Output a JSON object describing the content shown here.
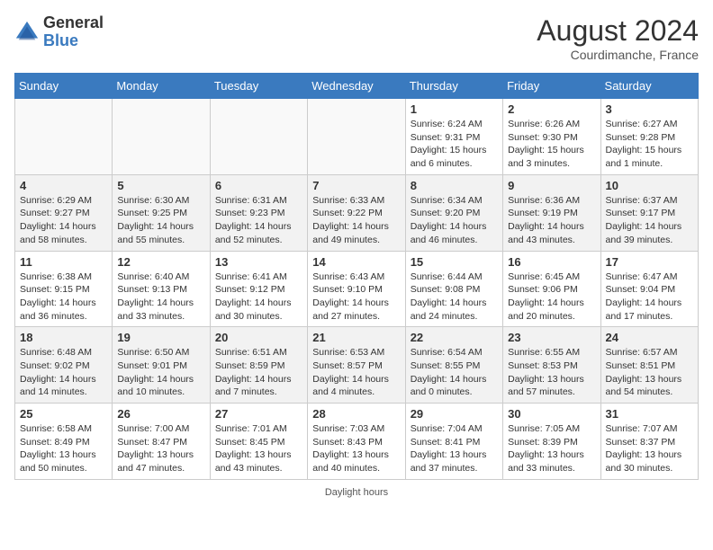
{
  "header": {
    "logo_general": "General",
    "logo_blue": "Blue",
    "month_year": "August 2024",
    "location": "Courdimanche, France"
  },
  "footer": {
    "note": "Daylight hours"
  },
  "weekdays": [
    "Sunday",
    "Monday",
    "Tuesday",
    "Wednesday",
    "Thursday",
    "Friday",
    "Saturday"
  ],
  "weeks": [
    [
      {
        "day": "",
        "info": ""
      },
      {
        "day": "",
        "info": ""
      },
      {
        "day": "",
        "info": ""
      },
      {
        "day": "",
        "info": ""
      },
      {
        "day": "1",
        "info": "Sunrise: 6:24 AM\nSunset: 9:31 PM\nDaylight: 15 hours\nand 6 minutes."
      },
      {
        "day": "2",
        "info": "Sunrise: 6:26 AM\nSunset: 9:30 PM\nDaylight: 15 hours\nand 3 minutes."
      },
      {
        "day": "3",
        "info": "Sunrise: 6:27 AM\nSunset: 9:28 PM\nDaylight: 15 hours\nand 1 minute."
      }
    ],
    [
      {
        "day": "4",
        "info": "Sunrise: 6:29 AM\nSunset: 9:27 PM\nDaylight: 14 hours\nand 58 minutes."
      },
      {
        "day": "5",
        "info": "Sunrise: 6:30 AM\nSunset: 9:25 PM\nDaylight: 14 hours\nand 55 minutes."
      },
      {
        "day": "6",
        "info": "Sunrise: 6:31 AM\nSunset: 9:23 PM\nDaylight: 14 hours\nand 52 minutes."
      },
      {
        "day": "7",
        "info": "Sunrise: 6:33 AM\nSunset: 9:22 PM\nDaylight: 14 hours\nand 49 minutes."
      },
      {
        "day": "8",
        "info": "Sunrise: 6:34 AM\nSunset: 9:20 PM\nDaylight: 14 hours\nand 46 minutes."
      },
      {
        "day": "9",
        "info": "Sunrise: 6:36 AM\nSunset: 9:19 PM\nDaylight: 14 hours\nand 43 minutes."
      },
      {
        "day": "10",
        "info": "Sunrise: 6:37 AM\nSunset: 9:17 PM\nDaylight: 14 hours\nand 39 minutes."
      }
    ],
    [
      {
        "day": "11",
        "info": "Sunrise: 6:38 AM\nSunset: 9:15 PM\nDaylight: 14 hours\nand 36 minutes."
      },
      {
        "day": "12",
        "info": "Sunrise: 6:40 AM\nSunset: 9:13 PM\nDaylight: 14 hours\nand 33 minutes."
      },
      {
        "day": "13",
        "info": "Sunrise: 6:41 AM\nSunset: 9:12 PM\nDaylight: 14 hours\nand 30 minutes."
      },
      {
        "day": "14",
        "info": "Sunrise: 6:43 AM\nSunset: 9:10 PM\nDaylight: 14 hours\nand 27 minutes."
      },
      {
        "day": "15",
        "info": "Sunrise: 6:44 AM\nSunset: 9:08 PM\nDaylight: 14 hours\nand 24 minutes."
      },
      {
        "day": "16",
        "info": "Sunrise: 6:45 AM\nSunset: 9:06 PM\nDaylight: 14 hours\nand 20 minutes."
      },
      {
        "day": "17",
        "info": "Sunrise: 6:47 AM\nSunset: 9:04 PM\nDaylight: 14 hours\nand 17 minutes."
      }
    ],
    [
      {
        "day": "18",
        "info": "Sunrise: 6:48 AM\nSunset: 9:02 PM\nDaylight: 14 hours\nand 14 minutes."
      },
      {
        "day": "19",
        "info": "Sunrise: 6:50 AM\nSunset: 9:01 PM\nDaylight: 14 hours\nand 10 minutes."
      },
      {
        "day": "20",
        "info": "Sunrise: 6:51 AM\nSunset: 8:59 PM\nDaylight: 14 hours\nand 7 minutes."
      },
      {
        "day": "21",
        "info": "Sunrise: 6:53 AM\nSunset: 8:57 PM\nDaylight: 14 hours\nand 4 minutes."
      },
      {
        "day": "22",
        "info": "Sunrise: 6:54 AM\nSunset: 8:55 PM\nDaylight: 14 hours\nand 0 minutes."
      },
      {
        "day": "23",
        "info": "Sunrise: 6:55 AM\nSunset: 8:53 PM\nDaylight: 13 hours\nand 57 minutes."
      },
      {
        "day": "24",
        "info": "Sunrise: 6:57 AM\nSunset: 8:51 PM\nDaylight: 13 hours\nand 54 minutes."
      }
    ],
    [
      {
        "day": "25",
        "info": "Sunrise: 6:58 AM\nSunset: 8:49 PM\nDaylight: 13 hours\nand 50 minutes."
      },
      {
        "day": "26",
        "info": "Sunrise: 7:00 AM\nSunset: 8:47 PM\nDaylight: 13 hours\nand 47 minutes."
      },
      {
        "day": "27",
        "info": "Sunrise: 7:01 AM\nSunset: 8:45 PM\nDaylight: 13 hours\nand 43 minutes."
      },
      {
        "day": "28",
        "info": "Sunrise: 7:03 AM\nSunset: 8:43 PM\nDaylight: 13 hours\nand 40 minutes."
      },
      {
        "day": "29",
        "info": "Sunrise: 7:04 AM\nSunset: 8:41 PM\nDaylight: 13 hours\nand 37 minutes."
      },
      {
        "day": "30",
        "info": "Sunrise: 7:05 AM\nSunset: 8:39 PM\nDaylight: 13 hours\nand 33 minutes."
      },
      {
        "day": "31",
        "info": "Sunrise: 7:07 AM\nSunset: 8:37 PM\nDaylight: 13 hours\nand 30 minutes."
      }
    ]
  ]
}
